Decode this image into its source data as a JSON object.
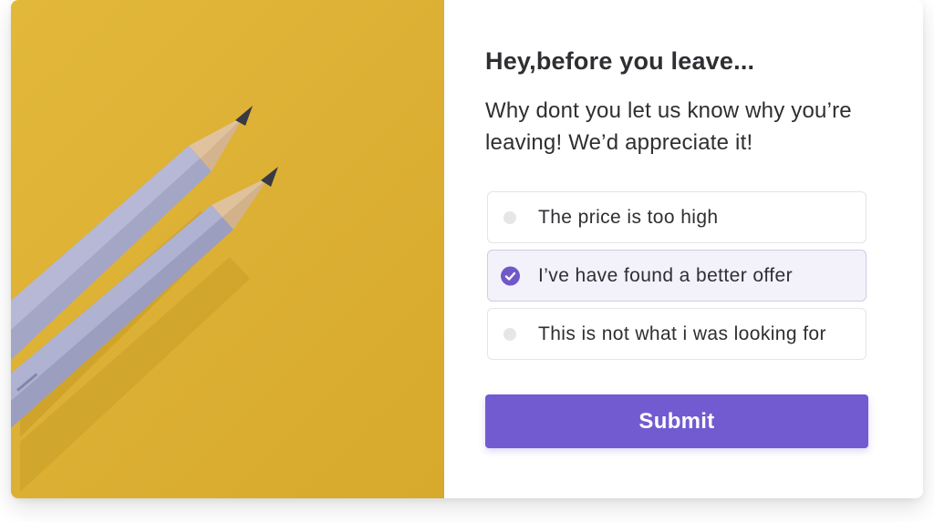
{
  "modal": {
    "title": "Hey,before you leave...",
    "subtitle": "Why dont you let us know why you’re leaving! We’d appreciate it!"
  },
  "options": [
    {
      "label": "The price is too high",
      "selected": false
    },
    {
      "label": "I’ve have found a better offer",
      "selected": true
    },
    {
      "label": "This is not what i was looking for",
      "selected": false
    }
  ],
  "submit": {
    "label": "Submit"
  },
  "image": {
    "subject": "two-pencils-on-yellow-background"
  },
  "colors": {
    "accent": "#725bd0",
    "image_background": "#dcb034",
    "text": "#2f2f33"
  }
}
